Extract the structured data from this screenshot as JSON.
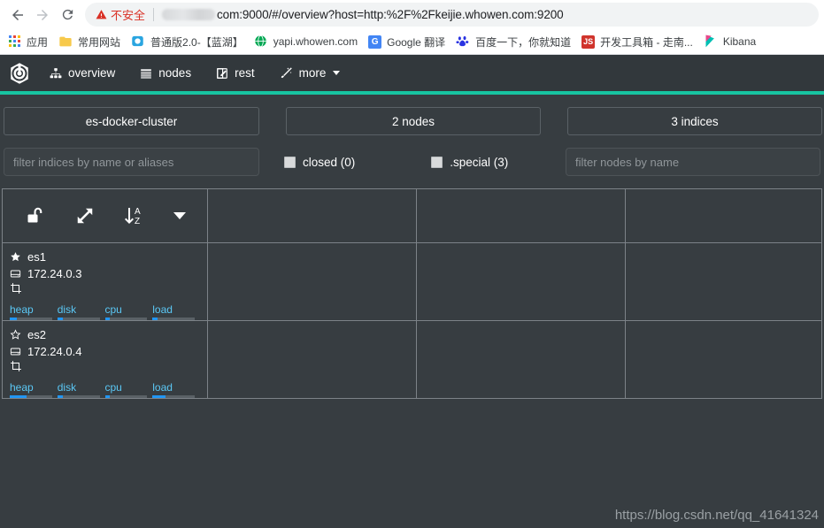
{
  "browser": {
    "back_icon": "back-arrow-icon",
    "forward_icon": "forward-arrow-icon",
    "reload_icon": "reload-icon",
    "security_label": "不安全",
    "url_text": "com:9000/#/overview?host=http:%2F%2Fkeijie.whowen.com:9200",
    "bookmarks": [
      {
        "label": "应用",
        "icon": "apps-grid-icon"
      },
      {
        "label": "常用网站",
        "icon": "folder-icon"
      },
      {
        "label": "普通版2.0-【蓝湖】",
        "icon": "lanhu-icon"
      },
      {
        "label": "yapi.whowen.com",
        "icon": "globe-icon"
      },
      {
        "label": "Google 翻译",
        "icon": "google-translate-icon"
      },
      {
        "label": "百度一下，你就知道",
        "icon": "baidu-icon"
      },
      {
        "label": "开发工具箱 - 走南...",
        "icon": "js-icon"
      },
      {
        "label": "Kibana",
        "icon": "kibana-icon"
      }
    ]
  },
  "app": {
    "logo_name": "cerebro-logo",
    "nav": [
      {
        "label": "overview",
        "icon": "sitemap-icon"
      },
      {
        "label": "nodes",
        "icon": "list-icon"
      },
      {
        "label": "rest",
        "icon": "edit-square-icon"
      },
      {
        "label": "more",
        "icon": "magic-wand-icon",
        "caret": true
      }
    ],
    "accent_color": "#17c4a1",
    "cluster": {
      "name": "es-docker-cluster",
      "nodes_summary": "2 nodes",
      "indices_summary": "3 indices"
    },
    "filters": {
      "indices_placeholder": "filter indices by name or aliases",
      "nodes_placeholder": "filter nodes by name",
      "indices_value": "",
      "nodes_value": "",
      "closed_label": "closed (0)",
      "special_label": ".special (3)",
      "closed_checked": false,
      "special_checked": false
    },
    "table_tools": [
      {
        "icon": "unlock-icon",
        "name": "toggle-lock"
      },
      {
        "icon": "expand-arrows-icon",
        "name": "toggle-expand"
      },
      {
        "icon": "sort-alpha-down-icon",
        "name": "sort-alpha"
      },
      {
        "icon": "chevron-down-icon",
        "name": "sort-direction"
      }
    ],
    "nodes": [
      {
        "name": "es1",
        "ip": "172.24.0.3",
        "master": true,
        "star_icon": "star-filled-icon",
        "ip_icon": "hdd-icon",
        "role_icon": "data-node-icon",
        "stats": [
          {
            "label": "heap",
            "percent": 16
          },
          {
            "label": "disk",
            "percent": 14
          },
          {
            "label": "cpu",
            "percent": 12
          },
          {
            "label": "load",
            "percent": 13
          }
        ]
      },
      {
        "name": "es2",
        "ip": "172.24.0.4",
        "master": false,
        "star_icon": "star-outline-icon",
        "ip_icon": "hdd-icon",
        "role_icon": "data-node-icon",
        "stats": [
          {
            "label": "heap",
            "percent": 40
          },
          {
            "label": "disk",
            "percent": 14
          },
          {
            "label": "cpu",
            "percent": 12
          },
          {
            "label": "load",
            "percent": 30
          }
        ]
      }
    ],
    "watermark": "https://blog.csdn.net/qq_41641324"
  }
}
